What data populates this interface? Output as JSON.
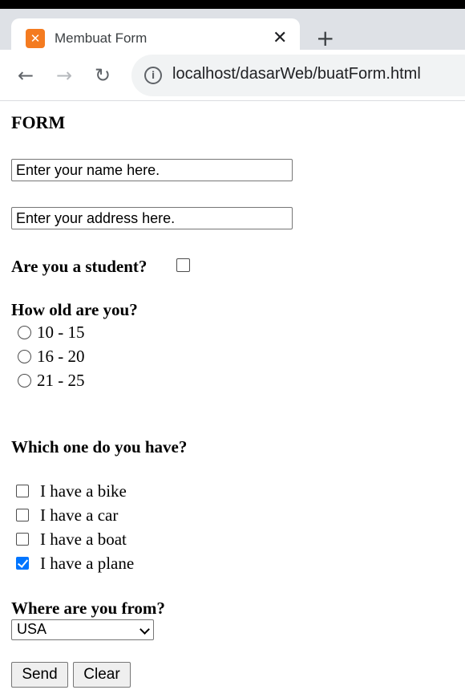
{
  "browser": {
    "tab_title": "Membuat Form",
    "tab_favicon": "xampp-icon",
    "close_glyph": "✕",
    "new_tab_glyph": "+",
    "back_glyph": "←",
    "forward_glyph": "→",
    "reload_glyph": "↻",
    "info_glyph": "i",
    "url": "localhost/dasarWeb/buatForm.html"
  },
  "form": {
    "heading": "FORM",
    "name_placeholder": "Enter your name here.",
    "address_placeholder": "Enter your address here.",
    "student_question": "Are you a student?",
    "student_checked": false,
    "age_question": "How old are you?",
    "age_options": [
      "10 - 15",
      "16 - 20",
      "21 - 25"
    ],
    "vehicle_question": "Which one do you have?",
    "vehicles": [
      {
        "label": "I have a bike",
        "checked": false
      },
      {
        "label": "I have a car",
        "checked": false
      },
      {
        "label": "I have a boat",
        "checked": false
      },
      {
        "label": "I have a plane",
        "checked": true
      }
    ],
    "origin_question": "Where are you from?",
    "origin_selected": "USA",
    "send_label": "Send",
    "clear_label": "Clear"
  },
  "colors": {
    "checkbox_checked": "#0075ff",
    "favicon": "#f47b20"
  }
}
